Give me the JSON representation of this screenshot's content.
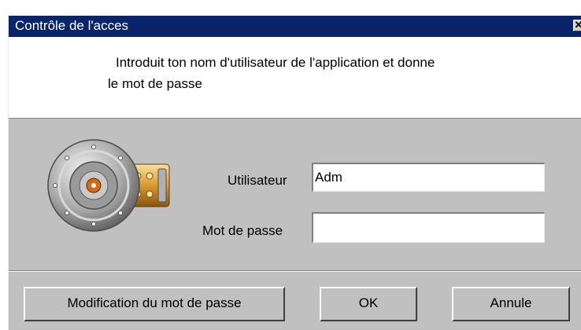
{
  "window": {
    "title": "Contrôle de l'acces",
    "close_glyph": "✕"
  },
  "header": {
    "message_line1": "Introduit ton nom d'utilisateur de l'application et donne",
    "message_line2": "le mot de passe"
  },
  "icon": {
    "name": "vault-lock-icon"
  },
  "form": {
    "user_label": "Utilisateur",
    "user_value": "Adm",
    "password_label": "Mot de passe",
    "password_value": ""
  },
  "buttons": {
    "change_password": "Modification du mot de passe",
    "ok": "OK",
    "cancel": "Annule"
  }
}
